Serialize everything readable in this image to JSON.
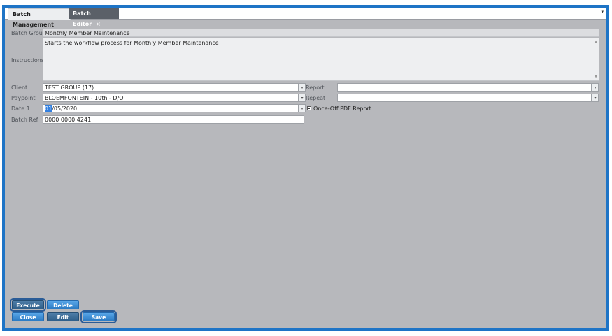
{
  "tabs": [
    {
      "label": "Batch Management",
      "active": false
    },
    {
      "label": "Batch Editor",
      "active": true,
      "close": "×"
    }
  ],
  "tab_menu_glyph": "▾",
  "form": {
    "batch_group": {
      "label": "Batch Group",
      "value": "Monthly Member Maintenance"
    },
    "instructions": {
      "label": "Instructions",
      "value": "Starts the workflow process for Monthly Member Maintenance"
    },
    "client": {
      "label": "Client",
      "value": "TEST GROUP (17)"
    },
    "paypoint": {
      "label": "Paypoint",
      "value": "BLOEMFONTEIN - 10th - D/O"
    },
    "date1": {
      "label": "Date 1",
      "value_selected": "01",
      "value_rest": "/05/2020"
    },
    "batch_ref": {
      "label": "Batch Ref",
      "value": "0000 0000 4241"
    },
    "report": {
      "label": "Report",
      "value": ""
    },
    "repeat": {
      "label": "Repeat",
      "value": ""
    },
    "once_off_pdf": {
      "label": "Once-Off PDF Report",
      "checked": true
    }
  },
  "drop_glyph": "▾",
  "buttons": {
    "execute": "Execute",
    "delete": "Delete",
    "close": "Close",
    "edit": "Edit",
    "save": "Save"
  },
  "colors": {
    "frame": "#1e74c6",
    "panel": "#b7b8bc",
    "button": "#2b7bc4"
  }
}
